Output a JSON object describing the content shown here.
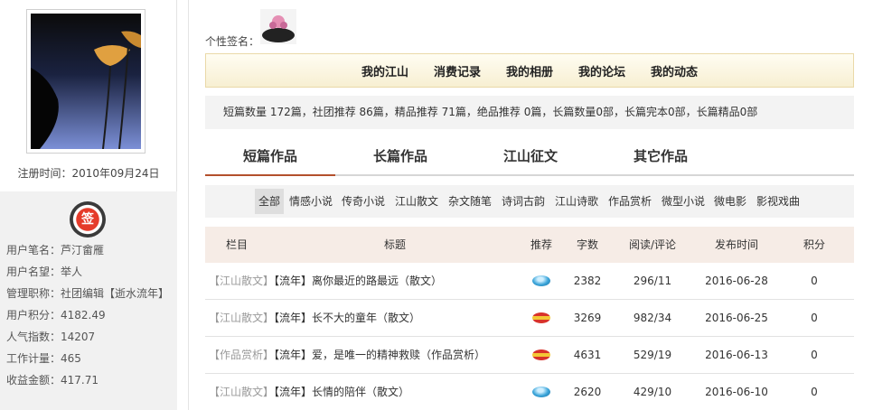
{
  "sidebar": {
    "reg_time": "注册时间：2010年09月24日",
    "badge_label": "签",
    "info": [
      "用户笔名：芦汀畲雁",
      "用户名望：举人",
      "管理职称：社团编辑【逝水流年】",
      "用户积分：4182.49",
      "人气指数：14207",
      "工作计量：465",
      "收益金额：417.71"
    ]
  },
  "signature": {
    "label": "个性签名："
  },
  "topnav": [
    "我的江山",
    "消费记录",
    "我的相册",
    "我的论坛",
    "我的动态"
  ],
  "stats": "短篇数量 172篇，社团推荐 86篇，精品推荐 71篇，绝品推荐 0篇，长篇数量0部，长篇完本0部，长篇精品0部",
  "worktabs": [
    "短篇作品",
    "长篇作品",
    "江山征文",
    "其它作品"
  ],
  "categories": [
    "全部",
    "情感小说",
    "传奇小说",
    "江山散文",
    "杂文随笔",
    "诗词古韵",
    "江山诗歌",
    "作品赏析",
    "微型小说",
    "微电影",
    "影视戏曲"
  ],
  "table": {
    "headers": [
      "栏目",
      "标题",
      "推荐",
      "字数",
      "阅读/评论",
      "发布时间",
      "积分"
    ],
    "rows": [
      {
        "category": "【江山散文】",
        "title": "【流年】离你最近的路最远（散文）",
        "rec": "blue",
        "words": "2382",
        "reads": "296/11",
        "date": "2016-06-28",
        "score": "0"
      },
      {
        "category": "【江山散文】",
        "title": "【流年】长不大的童年（散文）",
        "rec": "red",
        "words": "3269",
        "reads": "982/34",
        "date": "2016-06-25",
        "score": "0"
      },
      {
        "category": "【作品赏析】",
        "title": "【流年】爱，是唯一的精神救赎（作品赏析）",
        "rec": "red",
        "words": "4631",
        "reads": "529/19",
        "date": "2016-06-13",
        "score": "0"
      },
      {
        "category": "【江山散文】",
        "title": "【流年】长情的陪伴（散文）",
        "rec": "blue",
        "words": "2620",
        "reads": "429/10",
        "date": "2016-06-10",
        "score": "0"
      }
    ]
  }
}
